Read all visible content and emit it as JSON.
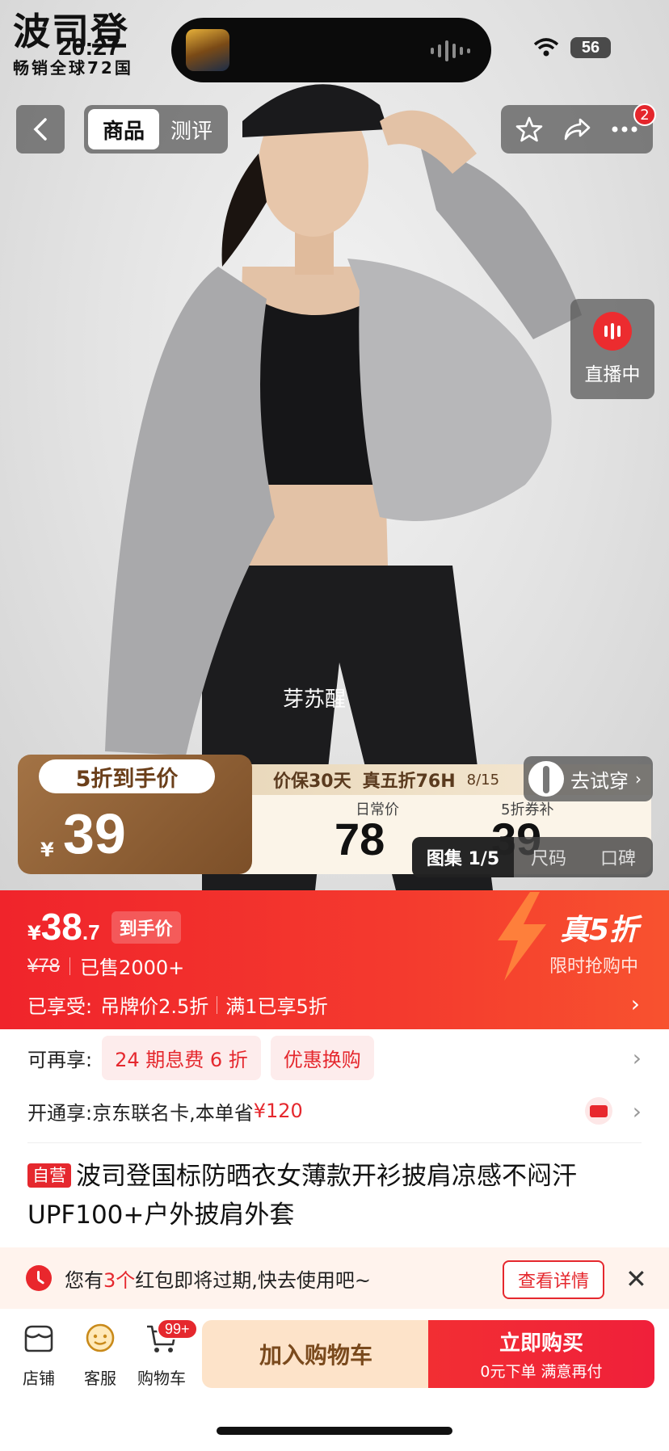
{
  "status_bar": {
    "time": "20:27",
    "battery": "56"
  },
  "brand": {
    "logo": "波司登",
    "subtitle": "畅销全球72国"
  },
  "nav": {
    "tabs": [
      {
        "label": "商品"
      },
      {
        "label": "测评"
      }
    ],
    "notification_count": "2"
  },
  "live": {
    "label": "直播中"
  },
  "hero": {
    "model_name": "芽苏醒"
  },
  "deal_banner": {
    "badge": "5折到手价",
    "currency": "¥",
    "price": "39",
    "tagline_1": "价保30天",
    "tagline_2": "真五折76H",
    "tagline_3": "8/15",
    "regular_label": "日常价",
    "regular_value": "78",
    "subsidy_label": "5折券补",
    "subsidy_value": "39"
  },
  "try_on": {
    "label": "去试穿"
  },
  "gallery": {
    "count": "图集 1/5",
    "size": "尺码",
    "reviews": "口碑"
  },
  "price_section": {
    "currency": "¥",
    "price_int": "38",
    "price_dec": ".7",
    "price_tag": "到手价",
    "original_price": "¥78",
    "sold": "已售2000+",
    "enjoyed_label": "已享受:",
    "enjoyed_1": "吊牌价2.5折",
    "enjoyed_2": "满1已享5折",
    "promo_title": "真5折",
    "promo_sub": "限时抢购中"
  },
  "benefits": {
    "more_label": "可再享:",
    "chip_1": "24 期息费 6 折",
    "chip_2": "优惠换购",
    "card_prefix": "开通享:京东联名卡,本单省",
    "card_save": "¥120"
  },
  "product": {
    "tag": "自营",
    "title": "波司登国标防晒衣女薄款开衫披肩凉感不闷汗UPF100+户外披肩外套"
  },
  "notice": {
    "prefix": "您有",
    "count": "3个",
    "suffix": "红包即将过期,快去使用吧~",
    "button": "查看详情"
  },
  "bottom_bar": {
    "store": "店铺",
    "service": "客服",
    "cart": "购物车",
    "cart_badge": "99+",
    "add_to_cart": "加入购物车",
    "buy_now": "立即购买",
    "buy_now_sub": "0元下单 满意再付"
  },
  "colors": {
    "brand_red": "#e5282e",
    "deal_brown": "#7c4f28",
    "add_cart_bg": "#fde3c9"
  }
}
